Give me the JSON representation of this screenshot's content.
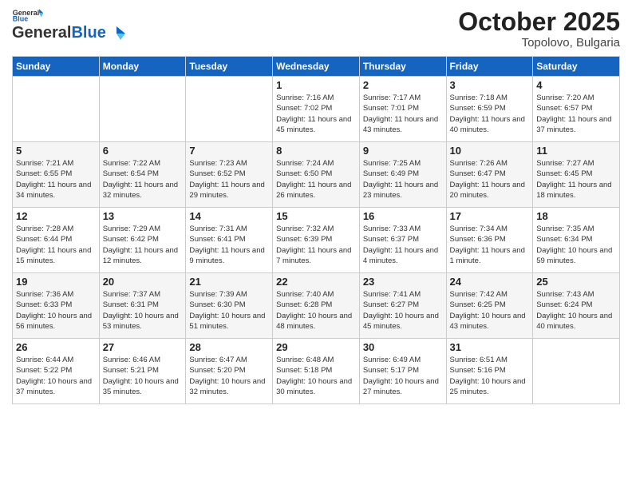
{
  "logo": {
    "general": "General",
    "blue": "Blue"
  },
  "header": {
    "month": "October 2025",
    "location": "Topolovo, Bulgaria"
  },
  "weekdays": [
    "Sunday",
    "Monday",
    "Tuesday",
    "Wednesday",
    "Thursday",
    "Friday",
    "Saturday"
  ],
  "weeks": [
    [
      {
        "day": "",
        "info": ""
      },
      {
        "day": "",
        "info": ""
      },
      {
        "day": "",
        "info": ""
      },
      {
        "day": "1",
        "info": "Sunrise: 7:16 AM\nSunset: 7:02 PM\nDaylight: 11 hours and 45 minutes."
      },
      {
        "day": "2",
        "info": "Sunrise: 7:17 AM\nSunset: 7:01 PM\nDaylight: 11 hours and 43 minutes."
      },
      {
        "day": "3",
        "info": "Sunrise: 7:18 AM\nSunset: 6:59 PM\nDaylight: 11 hours and 40 minutes."
      },
      {
        "day": "4",
        "info": "Sunrise: 7:20 AM\nSunset: 6:57 PM\nDaylight: 11 hours and 37 minutes."
      }
    ],
    [
      {
        "day": "5",
        "info": "Sunrise: 7:21 AM\nSunset: 6:55 PM\nDaylight: 11 hours and 34 minutes."
      },
      {
        "day": "6",
        "info": "Sunrise: 7:22 AM\nSunset: 6:54 PM\nDaylight: 11 hours and 32 minutes."
      },
      {
        "day": "7",
        "info": "Sunrise: 7:23 AM\nSunset: 6:52 PM\nDaylight: 11 hours and 29 minutes."
      },
      {
        "day": "8",
        "info": "Sunrise: 7:24 AM\nSunset: 6:50 PM\nDaylight: 11 hours and 26 minutes."
      },
      {
        "day": "9",
        "info": "Sunrise: 7:25 AM\nSunset: 6:49 PM\nDaylight: 11 hours and 23 minutes."
      },
      {
        "day": "10",
        "info": "Sunrise: 7:26 AM\nSunset: 6:47 PM\nDaylight: 11 hours and 20 minutes."
      },
      {
        "day": "11",
        "info": "Sunrise: 7:27 AM\nSunset: 6:45 PM\nDaylight: 11 hours and 18 minutes."
      }
    ],
    [
      {
        "day": "12",
        "info": "Sunrise: 7:28 AM\nSunset: 6:44 PM\nDaylight: 11 hours and 15 minutes."
      },
      {
        "day": "13",
        "info": "Sunrise: 7:29 AM\nSunset: 6:42 PM\nDaylight: 11 hours and 12 minutes."
      },
      {
        "day": "14",
        "info": "Sunrise: 7:31 AM\nSunset: 6:41 PM\nDaylight: 11 hours and 9 minutes."
      },
      {
        "day": "15",
        "info": "Sunrise: 7:32 AM\nSunset: 6:39 PM\nDaylight: 11 hours and 7 minutes."
      },
      {
        "day": "16",
        "info": "Sunrise: 7:33 AM\nSunset: 6:37 PM\nDaylight: 11 hours and 4 minutes."
      },
      {
        "day": "17",
        "info": "Sunrise: 7:34 AM\nSunset: 6:36 PM\nDaylight: 11 hours and 1 minute."
      },
      {
        "day": "18",
        "info": "Sunrise: 7:35 AM\nSunset: 6:34 PM\nDaylight: 10 hours and 59 minutes."
      }
    ],
    [
      {
        "day": "19",
        "info": "Sunrise: 7:36 AM\nSunset: 6:33 PM\nDaylight: 10 hours and 56 minutes."
      },
      {
        "day": "20",
        "info": "Sunrise: 7:37 AM\nSunset: 6:31 PM\nDaylight: 10 hours and 53 minutes."
      },
      {
        "day": "21",
        "info": "Sunrise: 7:39 AM\nSunset: 6:30 PM\nDaylight: 10 hours and 51 minutes."
      },
      {
        "day": "22",
        "info": "Sunrise: 7:40 AM\nSunset: 6:28 PM\nDaylight: 10 hours and 48 minutes."
      },
      {
        "day": "23",
        "info": "Sunrise: 7:41 AM\nSunset: 6:27 PM\nDaylight: 10 hours and 45 minutes."
      },
      {
        "day": "24",
        "info": "Sunrise: 7:42 AM\nSunset: 6:25 PM\nDaylight: 10 hours and 43 minutes."
      },
      {
        "day": "25",
        "info": "Sunrise: 7:43 AM\nSunset: 6:24 PM\nDaylight: 10 hours and 40 minutes."
      }
    ],
    [
      {
        "day": "26",
        "info": "Sunrise: 6:44 AM\nSunset: 5:22 PM\nDaylight: 10 hours and 37 minutes."
      },
      {
        "day": "27",
        "info": "Sunrise: 6:46 AM\nSunset: 5:21 PM\nDaylight: 10 hours and 35 minutes."
      },
      {
        "day": "28",
        "info": "Sunrise: 6:47 AM\nSunset: 5:20 PM\nDaylight: 10 hours and 32 minutes."
      },
      {
        "day": "29",
        "info": "Sunrise: 6:48 AM\nSunset: 5:18 PM\nDaylight: 10 hours and 30 minutes."
      },
      {
        "day": "30",
        "info": "Sunrise: 6:49 AM\nSunset: 5:17 PM\nDaylight: 10 hours and 27 minutes."
      },
      {
        "day": "31",
        "info": "Sunrise: 6:51 AM\nSunset: 5:16 PM\nDaylight: 10 hours and 25 minutes."
      },
      {
        "day": "",
        "info": ""
      }
    ]
  ],
  "colors": {
    "header_bg": "#1565c0",
    "header_text": "#ffffff",
    "row_even": "#f5f5f5",
    "row_odd": "#ffffff"
  }
}
